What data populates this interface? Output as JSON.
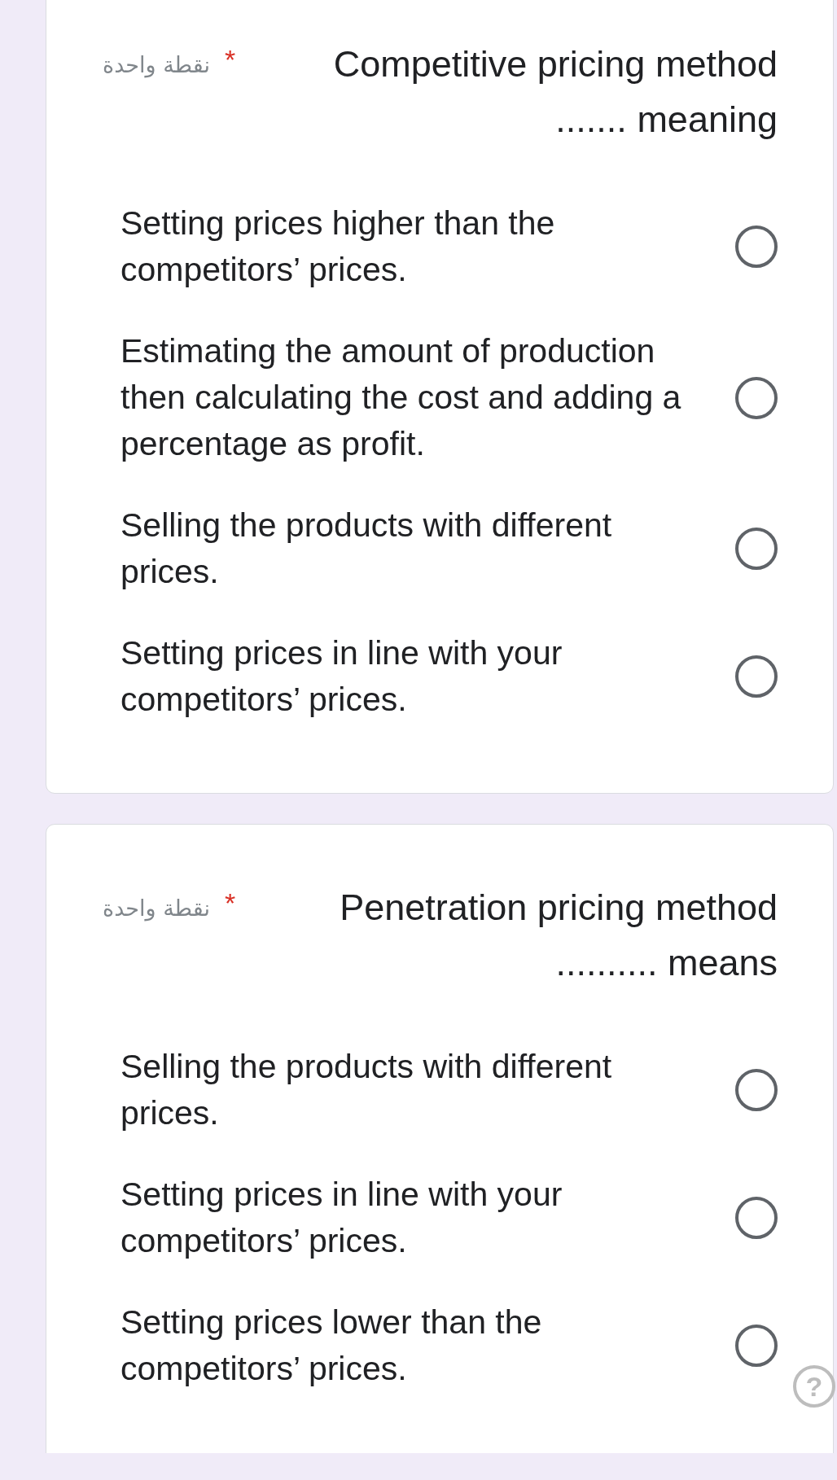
{
  "questions": [
    {
      "points": "نقطة واحدة",
      "required": true,
      "required_mark": "*",
      "title": "Competitive pricing method ....... meaning",
      "options": [
        {
          "label": "Setting prices higher than the competitors’ prices.",
          "selected": false
        },
        {
          "label": "Estimating the amount of production then calculating the cost and adding a percentage as profit.",
          "selected": false
        },
        {
          "label": "Selling the products with different prices.",
          "selected": false
        },
        {
          "label": "Setting prices in line with your competitors’ prices.",
          "selected": false
        }
      ]
    },
    {
      "points": "نقطة واحدة",
      "required": true,
      "required_mark": "*",
      "title": "Penetration pricing method .......... means",
      "options": [
        {
          "label": "Selling the products with different prices.",
          "selected": false
        },
        {
          "label": "Setting prices in line with your competitors’ prices.",
          "selected": false
        },
        {
          "label": "Setting prices lower than the competitors’ prices.",
          "selected": false
        }
      ]
    }
  ],
  "help_button": {
    "symbol": "?"
  }
}
